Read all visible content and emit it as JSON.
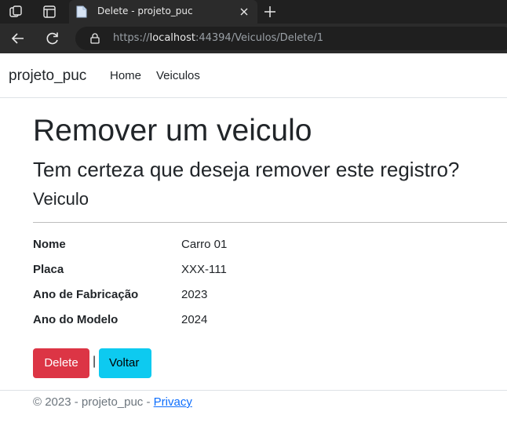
{
  "browser": {
    "tab_title": "Delete - projeto_puc",
    "url_scheme": "https://",
    "url_host": "localhost",
    "url_rest": ":44394/Veiculos/Delete/1"
  },
  "navbar": {
    "brand": "projeto_puc",
    "links": [
      {
        "label": "Home"
      },
      {
        "label": "Veiculos"
      }
    ]
  },
  "page": {
    "title": "Remover um veiculo",
    "confirm_text": "Tem certeza que deseja remover este registro?",
    "section_title": "Veiculo"
  },
  "details": [
    {
      "label": "Nome",
      "value": "Carro 01"
    },
    {
      "label": "Placa",
      "value": "XXX-111"
    },
    {
      "label": "Ano de Fabricação",
      "value": "2023"
    },
    {
      "label": "Ano do Modelo",
      "value": "2024"
    }
  ],
  "actions": {
    "delete_label": "Delete",
    "separator": "|",
    "back_label": "Voltar"
  },
  "footer": {
    "text": "© 2023 - projeto_puc - ",
    "link_label": "Privacy"
  },
  "colors": {
    "danger": "#dc3545",
    "info": "#0dcaf0",
    "link": "#0d6efd",
    "chrome_dark": "#202020"
  }
}
